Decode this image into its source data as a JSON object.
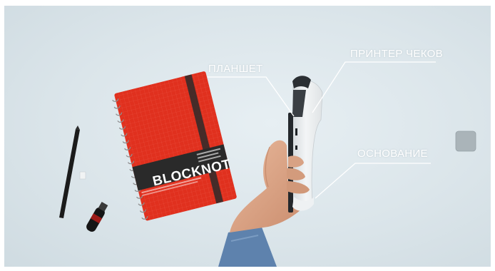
{
  "image": {
    "labels": {
      "tablet": "ПЛАНШЕТ",
      "printer": "ПРИНТЕР ЧЕКОВ",
      "base": "ОСНОВАНИЕ"
    },
    "notebook_brand": "BLOCKNOT"
  },
  "colors": {
    "background": "#dbe5ea",
    "notebook": "#e0301e",
    "label_band": "#2a2a2a",
    "device": "#e9ecee",
    "callout": "#ffffff"
  }
}
